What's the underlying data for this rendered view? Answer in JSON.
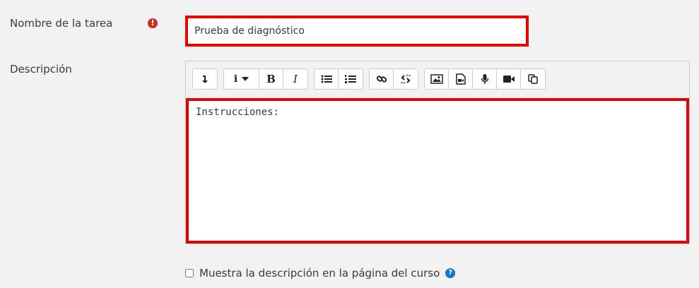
{
  "form": {
    "name_label": "Nombre de la tarea",
    "name_value": "Prueba de diagnóstico",
    "required_icon": "exclamation-circle-icon",
    "description_label": "Descripción",
    "description_text": "Instrucciones:",
    "show_description_label": "Muestra la descripción en la página del curso",
    "show_description_checked": false,
    "help_icon": "question-circle-icon",
    "required_color": "#ca3120",
    "highlight_color": "#e60000",
    "help_color": "#1177d1"
  },
  "toolbar": {
    "groups": [
      [
        "collapse-toolbar-icon"
      ],
      [
        "paragraph-styles-icon",
        "bold-icon",
        "italic-icon"
      ],
      [
        "unordered-list-icon",
        "ordered-list-icon"
      ],
      [
        "link-icon",
        "unlink-icon"
      ],
      [
        "image-icon",
        "media-file-icon",
        "record-audio-icon",
        "record-video-icon",
        "manage-files-icon"
      ]
    ],
    "glyphs": {
      "info": "i",
      "bold": "B",
      "italic": "I",
      "required": "!",
      "help": "?"
    }
  }
}
